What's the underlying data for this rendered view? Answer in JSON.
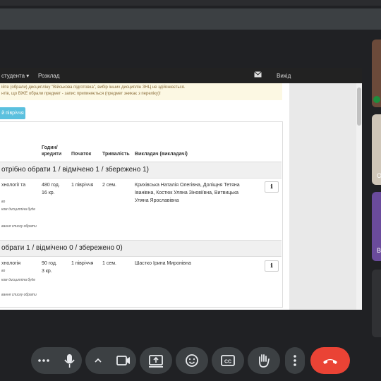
{
  "nav": {
    "student_menu": "студента ▾",
    "schedule": "Розклад",
    "logout": "Вихід"
  },
  "alert": {
    "line1": "ійте (обрали) дисципліну \"Військова підготовка\", вибір інших дисциплін ЗНЦ не здійснюється.",
    "line2": "нтів, що ВЖЕ обрали предмет - запис припиняється (предмет зникає з переліку)!"
  },
  "semester_button": "й півріччя",
  "table": {
    "headers": {
      "hours": "Годин/\nкредити",
      "start": "Початок",
      "duration": "Тривалість",
      "teacher": "Викладач (викладачі)"
    },
    "groups": [
      {
        "title": "отрібно обрати 1 / відмічено 1 / збережено 1)",
        "rows": [
          {
            "name": "хнології та",
            "name_extra": "во",
            "note1": "ком дисципліна буде",
            "note2": "вання списку обрати",
            "hours": "480 год.",
            "credits": "16 кр.",
            "start": "1 півріччя",
            "duration": "2 сем.",
            "teacher1": "Крихівська Наталія Олегівна, Доліщня Тетяна",
            "teacher2": "Іванівна, Костюк Уляна Зіновіївна, Витвицька",
            "teacher3": "Уляна Ярославівна"
          }
        ]
      },
      {
        "title": "обрати 1 / відмічено 0 / збережено 0)",
        "rows": [
          {
            "name": "хнологія",
            "name_extra": "во",
            "note1": "ком дисципліна буде",
            "note2": "вання списку обрати",
            "hours": "90 год.",
            "credits": "3 кр.",
            "start": "1 півріччя",
            "duration": "1 сем.",
            "teacher1": "Шастко Ірина Миронівна"
          }
        ]
      }
    ]
  },
  "colors": {
    "background": "#202124",
    "hangup": "#ea4335",
    "control": "#3c4043",
    "alert_bg": "#fcf8e3",
    "button_info": "#5bc0de"
  },
  "icons": [
    "more-icon",
    "mic-icon",
    "chevron-up-icon",
    "camera-icon",
    "present-icon",
    "emoji-icon",
    "captions-icon",
    "raise-hand-icon",
    "more-vert-icon",
    "hangup-icon",
    "mail-icon",
    "info-icon"
  ]
}
